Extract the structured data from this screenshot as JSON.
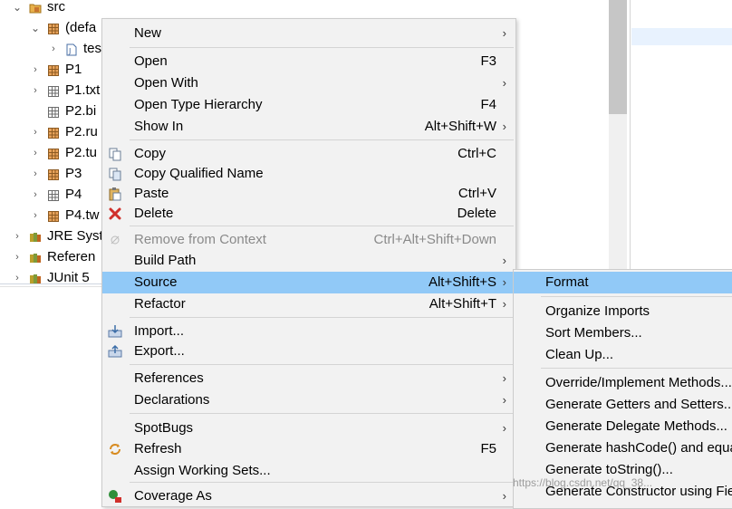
{
  "tree": {
    "items": [
      {
        "label": "src",
        "indent": 0,
        "twisty": "expanded",
        "icon": "source-folder-icon"
      },
      {
        "label": "(defa",
        "indent": 1,
        "twisty": "expanded",
        "icon": "package-icon"
      },
      {
        "label": "tes",
        "indent": 2,
        "twisty": "collapsed",
        "icon": "java-file-icon"
      },
      {
        "label": "P1",
        "indent": 1,
        "twisty": "collapsed",
        "icon": "package-icon"
      },
      {
        "label": "P1.txt",
        "indent": 1,
        "twisty": "collapsed",
        "icon": "package-empty-icon"
      },
      {
        "label": "P2.bi",
        "indent": 1,
        "twisty": "none",
        "icon": "package-empty-icon"
      },
      {
        "label": "P2.ru",
        "indent": 1,
        "twisty": "collapsed",
        "icon": "package-icon"
      },
      {
        "label": "P2.tu",
        "indent": 1,
        "twisty": "collapsed",
        "icon": "package-icon"
      },
      {
        "label": "P3",
        "indent": 1,
        "twisty": "collapsed",
        "icon": "package-icon"
      },
      {
        "label": "P4",
        "indent": 1,
        "twisty": "collapsed",
        "icon": "package-empty-icon"
      },
      {
        "label": "P4.tw",
        "indent": 1,
        "twisty": "collapsed",
        "icon": "package-icon"
      },
      {
        "label": "JRE Syst",
        "indent": 0,
        "twisty": "collapsed",
        "icon": "library-icon"
      },
      {
        "label": "Referen",
        "indent": 0,
        "twisty": "collapsed",
        "icon": "library-icon"
      },
      {
        "label": "JUnit 5",
        "indent": 0,
        "twisty": "collapsed",
        "icon": "library-icon"
      }
    ]
  },
  "context_menu": {
    "items": [
      {
        "label": "New",
        "accel": "",
        "submenu": true
      },
      {
        "label": "Open",
        "accel": "F3",
        "submenu": false
      },
      {
        "label": "Open With",
        "accel": "",
        "submenu": true
      },
      {
        "label": "Open Type Hierarchy",
        "accel": "F4",
        "submenu": false
      },
      {
        "label": "Show In",
        "accel": "Alt+Shift+W",
        "submenu": true
      },
      {
        "label": "Copy",
        "accel": "Ctrl+C",
        "submenu": false,
        "icon": "copy-icon"
      },
      {
        "label": "Copy Qualified Name",
        "accel": "",
        "submenu": false,
        "icon": "copy-qualified-icon"
      },
      {
        "label": "Paste",
        "accel": "Ctrl+V",
        "submenu": false,
        "icon": "paste-icon"
      },
      {
        "label": "Delete",
        "accel": "Delete",
        "submenu": false,
        "icon": "delete-icon"
      },
      {
        "label": "Remove from Context",
        "accel": "Ctrl+Alt+Shift+Down",
        "submenu": false,
        "disabled": true,
        "icon": "remove-context-icon"
      },
      {
        "label": "Build Path",
        "accel": "",
        "submenu": true
      },
      {
        "label": "Source",
        "accel": "Alt+Shift+S",
        "submenu": true,
        "highlighted": true
      },
      {
        "label": "Refactor",
        "accel": "Alt+Shift+T",
        "submenu": true
      },
      {
        "label": "Import...",
        "accel": "",
        "submenu": false,
        "icon": "import-icon"
      },
      {
        "label": "Export...",
        "accel": "",
        "submenu": false,
        "icon": "export-icon"
      },
      {
        "label": "References",
        "accel": "",
        "submenu": true
      },
      {
        "label": "Declarations",
        "accel": "",
        "submenu": true
      },
      {
        "label": "SpotBugs",
        "accel": "",
        "submenu": true
      },
      {
        "label": "Refresh",
        "accel": "F5",
        "submenu": false,
        "icon": "refresh-icon"
      },
      {
        "label": "Assign Working Sets...",
        "accel": "",
        "submenu": false
      },
      {
        "label": "Coverage As",
        "accel": "",
        "submenu": true,
        "icon": "coverage-icon"
      }
    ]
  },
  "source_submenu": {
    "items": [
      {
        "label": "Format",
        "highlighted": true
      },
      {
        "label": "Organize Imports"
      },
      {
        "label": "Sort Members..."
      },
      {
        "label": "Clean Up..."
      },
      {
        "label": "Override/Implement Methods..."
      },
      {
        "label": "Generate Getters and Setters..."
      },
      {
        "label": "Generate Delegate Methods..."
      },
      {
        "label": "Generate hashCode() and equals()..."
      },
      {
        "label": "Generate toString()..."
      },
      {
        "label": "Generate Constructor using Fields..."
      }
    ]
  },
  "watermark": "https://blog.csdn.net/qq_38...",
  "colors": {
    "menu_bg": "#f2f2f2",
    "highlight": "#91c9f7",
    "disabled_text": "#8a8a8a"
  }
}
